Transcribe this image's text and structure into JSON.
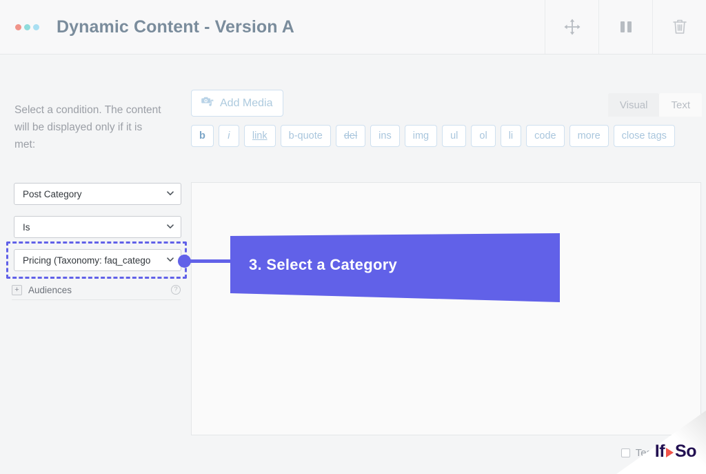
{
  "window": {
    "title": "Dynamic Content - Version A",
    "dots": [
      "salmon-dot",
      "teal-dot",
      "sky-dot"
    ],
    "actions": [
      {
        "name": "move-handle-icon",
        "label": "Move"
      },
      {
        "name": "pause-icon",
        "label": "Pause"
      },
      {
        "name": "trash-icon",
        "label": "Delete"
      }
    ],
    "colors": {
      "dot_1": "#f0948a",
      "dot_2": "#8fdcdc",
      "dot_3": "#a9dff2",
      "title_text": "#7a8c9c",
      "titlebar_bg": "#f8f8f9"
    }
  },
  "sidebar": {
    "instructions": "Select a condition. The content will be displayed only if it is met:",
    "condition_select": {
      "value": "Post Category",
      "chevron": "chevron-down-icon"
    },
    "operator_select": {
      "value": "Is",
      "chevron": "chevron-down-icon"
    },
    "value_select": {
      "value": "Pricing (Taxonomy: faq_catego",
      "chevron": "chevron-down-icon",
      "highlighted": true
    },
    "audiences": {
      "expander": "+",
      "label": "Audiences",
      "help": "?"
    }
  },
  "editor": {
    "add_media": {
      "label": "Add Media",
      "icon": "media-camera-icon"
    },
    "mode_tabs": [
      {
        "label": "Visual",
        "active": false
      },
      {
        "label": "Text",
        "active": true
      }
    ],
    "quicktags": [
      {
        "label": "b",
        "style": "bold"
      },
      {
        "label": "i",
        "style": "italic"
      },
      {
        "label": "link",
        "style": "underline"
      },
      {
        "label": "b-quote",
        "style": "plain"
      },
      {
        "label": "del",
        "style": "strike"
      },
      {
        "label": "ins",
        "style": "plain"
      },
      {
        "label": "img",
        "style": "plain"
      },
      {
        "label": "ul",
        "style": "plain"
      },
      {
        "label": "ol",
        "style": "plain"
      },
      {
        "label": "li",
        "style": "plain"
      },
      {
        "label": "code",
        "style": "plain"
      },
      {
        "label": "more",
        "style": "plain"
      },
      {
        "label": "close tags",
        "style": "plain"
      }
    ],
    "content": ""
  },
  "callout": {
    "text": "3. Select a Category",
    "color": "#6161e8",
    "text_color": "#ffffff"
  },
  "footer": {
    "testing_label": "Testing M",
    "checkbox_checked": false,
    "logo": {
      "part1": "If",
      "separator": "play-triangle-icon",
      "part2": "So",
      "text_color": "#231152",
      "accent_color": "#f0544a"
    }
  }
}
